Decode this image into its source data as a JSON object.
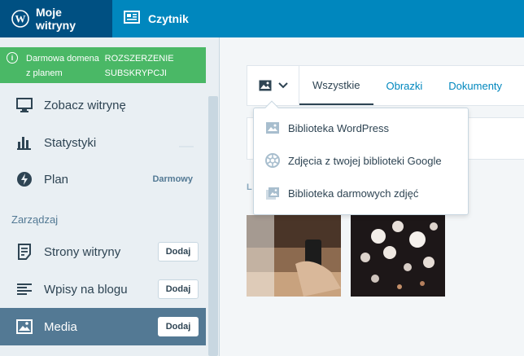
{
  "topbar": {
    "my_sites": "Moje witryny",
    "reader": "Czytnik"
  },
  "sidebar": {
    "promo": {
      "text": "Darmowa domena z planem",
      "cta": "ROZSZERZENIE SUBSKRYPCJI"
    },
    "items": [
      {
        "label": "Zobacz witrynę"
      },
      {
        "label": "Statystyki"
      },
      {
        "label": "Plan",
        "badge": "Darmowy"
      }
    ],
    "section": "Zarządzaj",
    "manage_items": [
      {
        "label": "Strony witryny",
        "button": "Dodaj"
      },
      {
        "label": "Wpisy na blogu",
        "button": "Dodaj"
      },
      {
        "label": "Media",
        "button": "Dodaj"
      }
    ]
  },
  "media": {
    "tabs": [
      "Wszystkie",
      "Obrazki",
      "Dokumenty"
    ],
    "partial_label": "L",
    "dropdown": [
      {
        "label": "Biblioteka WordPress",
        "icon": "image-icon"
      },
      {
        "label": "Zdjęcia z twojej biblioteki Google",
        "icon": "google-photos-icon"
      },
      {
        "label": "Biblioteka darmowych zdjęć",
        "icon": "free-photos-icon"
      }
    ]
  },
  "colors": {
    "brand": "#0087be",
    "brand_dark": "#005082",
    "promo": "#4ab866",
    "selected": "#537994"
  }
}
